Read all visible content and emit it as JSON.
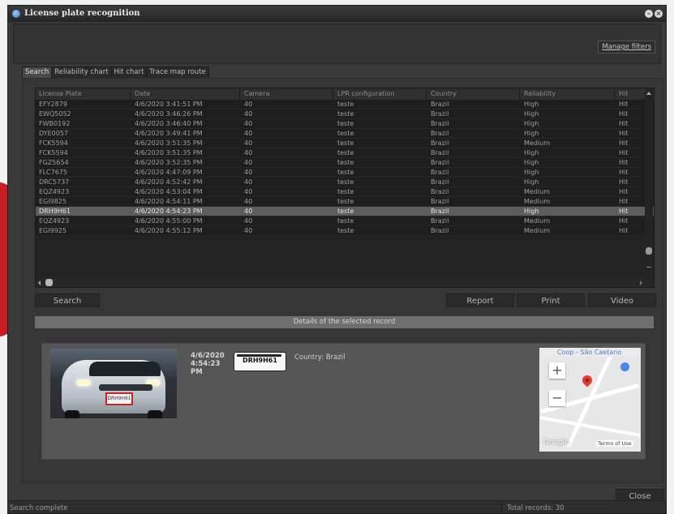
{
  "window": {
    "title": "License plate recognition"
  },
  "toolbar": {
    "manage_filters": "Manage filters"
  },
  "tabs": [
    "Search",
    "Reliability chart",
    "Hit chart",
    "Trace map route"
  ],
  "table": {
    "headers": [
      "License Plate",
      "Date",
      "Camera",
      "LPR configuration",
      "Country",
      "Reliability",
      "Hit"
    ],
    "rows": [
      [
        "EFY2879",
        "4/6/2020 3:41:51 PM",
        "40",
        "teste",
        "Brazil",
        "High",
        "Hit"
      ],
      [
        "EWQ5052",
        "4/6/2020 3:46:26 PM",
        "40",
        "teste",
        "Brazil",
        "High",
        "Hit"
      ],
      [
        "FWB0192",
        "4/6/2020 3:46:40 PM",
        "40",
        "teste",
        "Brazil",
        "High",
        "Hit"
      ],
      [
        "DYE0057",
        "4/6/2020 3:49:41 PM",
        "40",
        "teste",
        "Brazil",
        "High",
        "Hit"
      ],
      [
        "FCK5594",
        "4/6/2020 3:51:35 PM",
        "40",
        "teste",
        "Brazil",
        "Medium",
        "Hit"
      ],
      [
        "FCK5594",
        "4/6/2020 3:51:35 PM",
        "40",
        "teste",
        "Brazil",
        "High",
        "Hit"
      ],
      [
        "FGZ5654",
        "4/6/2020 3:52:35 PM",
        "40",
        "teste",
        "Brazil",
        "High",
        "Hit"
      ],
      [
        "FLC7675",
        "4/6/2020 4:47:09 PM",
        "40",
        "teste",
        "Brazil",
        "High",
        "Hit"
      ],
      [
        "DRC5737",
        "4/6/2020 4:52:42 PM",
        "40",
        "teste",
        "Brazil",
        "High",
        "Hit"
      ],
      [
        "EQZ4923",
        "4/6/2020 4:53:04 PM",
        "40",
        "teste",
        "Brazil",
        "Medium",
        "Hit"
      ],
      [
        "EGI9825",
        "4/6/2020 4:54:11 PM",
        "40",
        "teste",
        "Brazil",
        "Medium",
        "Hit"
      ],
      [
        "DRH9H61",
        "4/6/2020 4:54:23 PM",
        "40",
        "teste",
        "Brazil",
        "High",
        "Hit"
      ],
      [
        "EQZ4923",
        "4/6/2020 4:55:00 PM",
        "40",
        "teste",
        "Brazil",
        "Medium",
        "Hit"
      ],
      [
        "EGI9925",
        "4/6/2020 4:55:12 PM",
        "40",
        "teste",
        "Brazil",
        "Medium",
        "Hit"
      ]
    ],
    "selected_row": 11
  },
  "buttons": {
    "search": "Search",
    "report": "Report",
    "print": "Print",
    "video": "Video",
    "close": "Close"
  },
  "details": {
    "header": "Details of the selected record",
    "date_line1": "4/6/2020",
    "date_line2": "4:54:23",
    "date_line3": "PM",
    "plate": "DRH9H61",
    "country_label": "Country: Brazil",
    "image_plate": "DRH9H61"
  },
  "map": {
    "place_label": "Coop - São Caetano",
    "zoom_in": "+",
    "zoom_out": "−",
    "logo": "Google",
    "terms": "Terms of Use"
  },
  "status": {
    "left": "Search complete",
    "right": "Total records: 30"
  }
}
